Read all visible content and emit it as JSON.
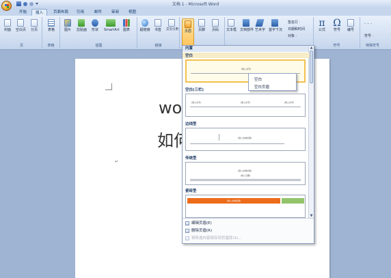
{
  "window": {
    "title": "文档 1 - Microsoft Word"
  },
  "tabs": [
    "开始",
    "插入",
    "页面布局",
    "引用",
    "邮件",
    "审阅",
    "视图"
  ],
  "active_tab": "插入",
  "ribbon": {
    "groups": {
      "pages": {
        "label": "页",
        "buttons": [
          "封面",
          "空白页",
          "分页"
        ]
      },
      "tables": {
        "label": "表格",
        "buttons": [
          "表格"
        ]
      },
      "illustrations": {
        "label": "插图",
        "buttons": [
          "图片",
          "剪贴画",
          "形状",
          "SmartArt",
          "图表"
        ]
      },
      "links": {
        "label": "链接",
        "buttons": [
          "超链接",
          "书签",
          "交叉引用"
        ]
      },
      "header_footer": {
        "buttons": [
          "页眉",
          "页脚",
          "页码"
        ]
      },
      "text": {
        "buttons": [
          "文本框",
          "文档部件",
          "艺术字",
          "首字下沉"
        ],
        "small": [
          "签名行 ·",
          "日期和时间",
          "对象 ·"
        ]
      },
      "symbols": {
        "label": "符号",
        "buttons": [
          "公式",
          "符号",
          "编号"
        ]
      },
      "special": {
        "label": "特殊符号",
        "small": [
          "符号 ·"
        ]
      }
    }
  },
  "document": {
    "line1": "wo",
    "line2": "如何"
  },
  "gallery": {
    "header": "内置",
    "items": [
      {
        "label": "空白"
      },
      {
        "label": "空白(三栏)"
      },
      {
        "label": "边线型"
      },
      {
        "label": "传统型"
      },
      {
        "label": "瓷砖型"
      }
    ],
    "thumb_texts": {
      "blank": "[键入文字]",
      "three_col": [
        "[键入文字]",
        "[键入文字]",
        "[键入文字]"
      ],
      "edge": "[键入文档标题]",
      "traditional": [
        "[键入文档标题]",
        "[键入日期]"
      ],
      "tile": "[键入文档标题]"
    },
    "footer_menu": [
      {
        "label": "编辑页眉(E)",
        "enabled": true
      },
      {
        "label": "删除页眉(R)",
        "enabled": true
      },
      {
        "label": "将所选内容保存到页眉库(S)...",
        "enabled": false
      }
    ]
  },
  "popup": {
    "items": [
      "空白",
      "空白页眉"
    ]
  }
}
